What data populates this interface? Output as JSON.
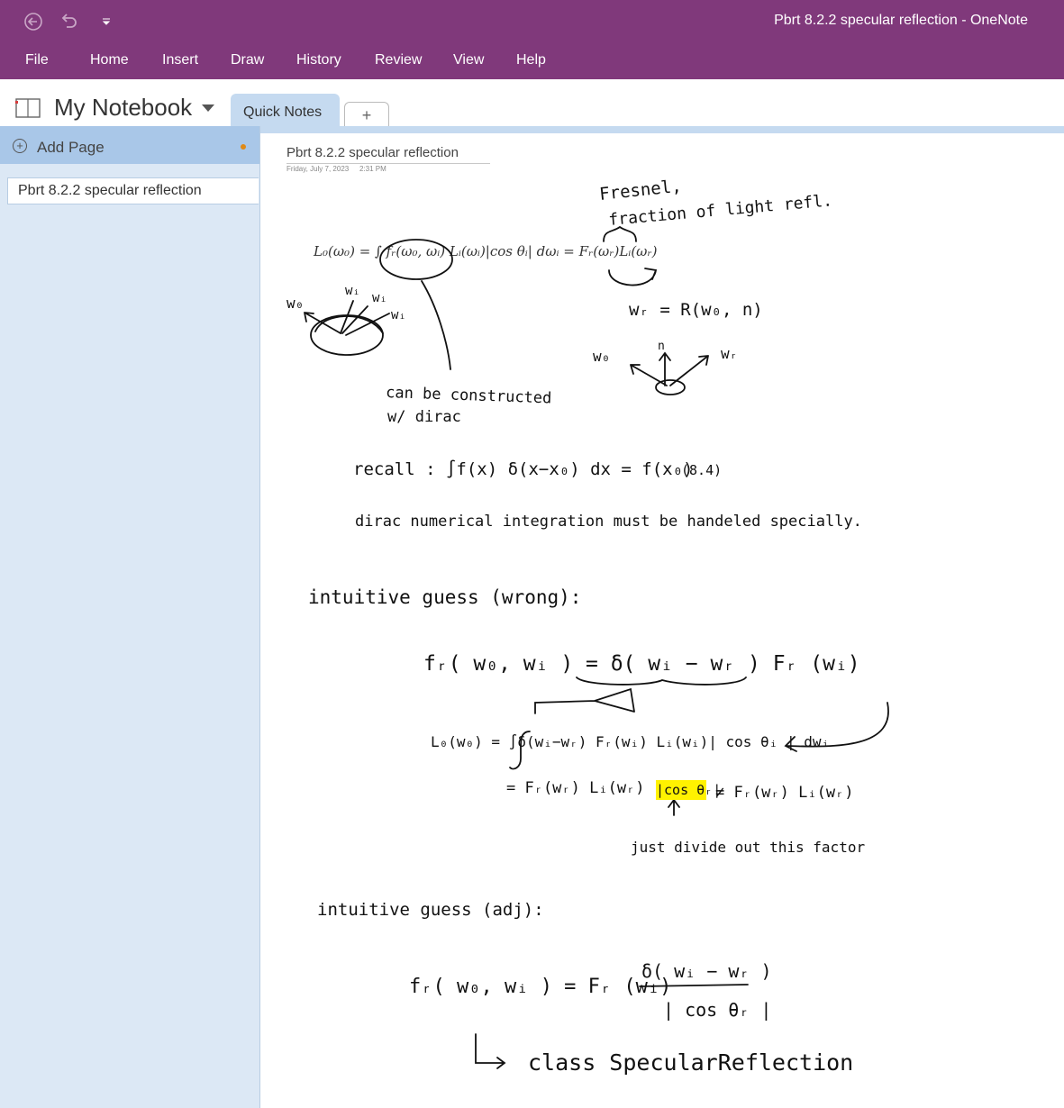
{
  "window": {
    "title": "Pbrt 8.2.2 specular reflection  -  OneNote"
  },
  "quick_access": {
    "back_icon": "back-arrow-icon",
    "undo_icon": "undo-icon",
    "customize_icon": "customize-caret-icon"
  },
  "ribbon_tabs": [
    "File",
    "Home",
    "Insert",
    "Draw",
    "History",
    "Review",
    "View",
    "Help"
  ],
  "notebook": {
    "name": "My Notebook",
    "section_tab": "Quick Notes",
    "add_tab": "+"
  },
  "sidebar": {
    "add_page": "Add Page",
    "pages": [
      "Pbrt 8.2.2 specular reflection"
    ]
  },
  "page": {
    "title": "Pbrt 8.2.2 specular reflection",
    "date": "Friday, July 7, 2023",
    "time": "2:31 PM",
    "rendering_equation": "L₀(ω₀) = ∫ fᵣ(ω₀, ωᵢ) Lᵢ(ωᵢ)|cos θᵢ| dωᵢ = Fᵣ(ωᵣ)Lᵢ(ωᵣ)",
    "ink": {
      "fresnel": "Fresnel,",
      "fresnel_note": "fraction of light refl.",
      "wo": "w₀",
      "wi": "wᵢ",
      "wr_def": "wᵣ = R(w₀, n)",
      "wr": "wᵣ",
      "n": "n",
      "constructed_1": "can be constructed",
      "constructed_2": "w/ dirac",
      "recall": "recall :  ∫f(x) δ(x−x₀) dx = f(x₀)",
      "eq_num": "(8.4)",
      "numerical": "dirac  numerical integration  must be handeled specially.",
      "guess_wrong": "intuitive guess (wrong):",
      "fr_wrong": "fᵣ( w₀, wᵢ ) = δ( wᵢ − wᵣ ) Fᵣ (wᵢ)",
      "lo_integral": "L₀(w₀) = ∫δ(wᵢ−wᵣ) Fᵣ(wᵢ) Lᵢ(wᵢ)| cos θᵢ | dwᵢ",
      "lo_result_a": "= Fᵣ(wᵣ) Lᵢ(wᵣ)",
      "cos_highlight": "|cos θᵣ|",
      "lo_result_b": "≠ Fᵣ(wᵣ) Lᵢ(wᵣ)",
      "divide_note": "just divide out this factor",
      "guess_ok": "intuitive guess (adj):",
      "fr_correct_lhs": "fᵣ( w₀, wᵢ ) = Fᵣ (wᵢ)",
      "fr_numerator": "δ( wᵢ − wᵣ )",
      "fr_denominator": "| cos θᵣ |",
      "class_note": "class SpecularReflection"
    }
  },
  "colors": {
    "title_bar": "#80397b",
    "sidebar": "#dce8f5",
    "add_page_bar": "#a9c7e8",
    "highlight": "#fff200"
  }
}
